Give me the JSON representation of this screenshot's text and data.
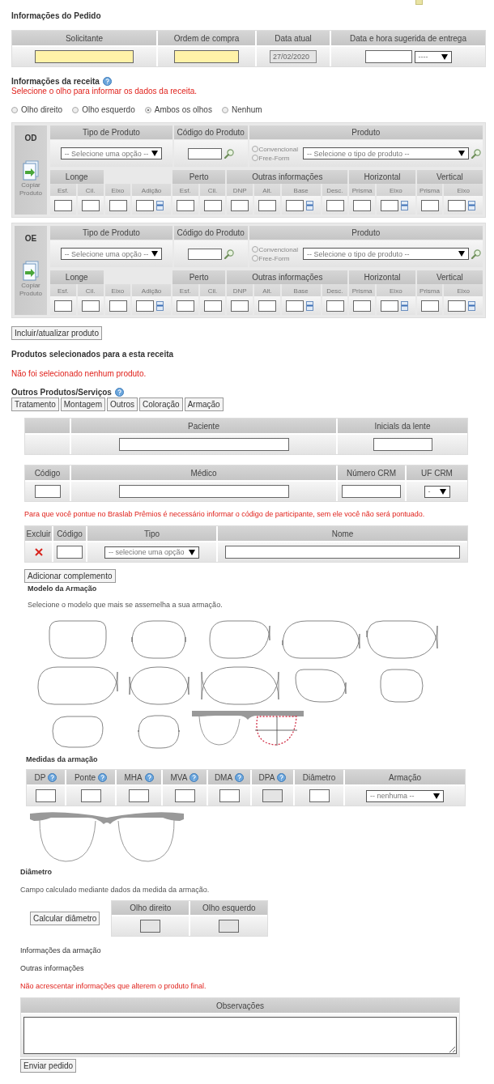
{
  "order": {
    "title": "Informações do Pedido",
    "headers": [
      "Solicitante",
      "Ordem de compra",
      "Data atual",
      "Data e hora sugerida de entrega"
    ],
    "fields": [
      {
        "kind": "text",
        "highlighted": true
      },
      {
        "kind": "text",
        "highlighted": true
      },
      {
        "kind": "readonly",
        "highlighted": false,
        "value": "27/02/2020"
      },
      {
        "kind": "datetime",
        "highlighted": false,
        "option": "----"
      }
    ]
  },
  "prescription": {
    "title": "Informações da receita",
    "note": "Selecione o olho para informar os dados da receita.",
    "eyes": [
      {
        "label": "Olho direito",
        "selected": false
      },
      {
        "label": "Olho esquerdo",
        "selected": false
      },
      {
        "label": "Ambos os olhos",
        "selected": true
      },
      {
        "label": "Nenhum",
        "selected": false
      }
    ]
  },
  "eye_panels": [
    {
      "eye": "OD",
      "copy_label": "Copiar Produto",
      "headers": [
        "Tipo de Produto",
        "Código do Produto",
        "Produto"
      ],
      "type_option": "-- Selecione uma opção --",
      "lens_options": [
        {
          "label": "Convencional",
          "selected": false
        },
        {
          "label": "Free-Form",
          "selected": false
        }
      ],
      "product_option": "-- Selecione o tipo de produto --",
      "groups": [
        {
          "label": "Longe",
          "columns": [
            {
              "label": "Esf.",
              "picker": false
            },
            {
              "label": "Cil.",
              "picker": false
            }
          ]
        },
        {
          "columns": [
            {
              "label": "Eixo",
              "picker": false
            },
            {
              "label": "Adição",
              "picker": true
            }
          ]
        },
        {
          "label": "Perto",
          "columns": [
            {
              "label": "Esf.",
              "picker": false
            },
            {
              "label": "Cil.",
              "picker": false
            }
          ]
        },
        {
          "label": "Outras informações",
          "columns": [
            {
              "label": "DNP",
              "picker": false
            },
            {
              "label": "Alt.",
              "picker": false
            },
            {
              "label": "Base",
              "picker": true
            },
            {
              "label": "Desc.",
              "picker": false
            }
          ]
        },
        {
          "label": "Horizontal",
          "columns": [
            {
              "label": "Prisma",
              "picker": false
            },
            {
              "label": "Eixo",
              "picker": true
            }
          ]
        },
        {
          "label": "Vertical",
          "columns": [
            {
              "label": "Prisma",
              "picker": false
            },
            {
              "label": "Eixo",
              "picker": true
            }
          ]
        }
      ]
    },
    {
      "eye": "OE",
      "copy_label": "Copiar Produto",
      "headers": [
        "Tipo de Produto",
        "Código do Produto",
        "Produto"
      ],
      "type_option": "-- Selecione uma opção --",
      "lens_options": [
        {
          "label": "Convencional",
          "selected": false
        },
        {
          "label": "Free-Form",
          "selected": false
        }
      ],
      "product_option": "-- Selecione o tipo de produto --",
      "groups": [
        {
          "label": "Longe",
          "columns": [
            {
              "label": "Esf.",
              "picker": false
            },
            {
              "label": "Cil.",
              "picker": false
            }
          ]
        },
        {
          "columns": [
            {
              "label": "Eixo",
              "picker": false
            },
            {
              "label": "Adição",
              "picker": true
            }
          ]
        },
        {
          "label": "Perto",
          "columns": [
            {
              "label": "Esf.",
              "picker": false
            },
            {
              "label": "Cil.",
              "picker": false
            }
          ]
        },
        {
          "label": "Outras informações",
          "columns": [
            {
              "label": "DNP",
              "picker": false
            },
            {
              "label": "Alt.",
              "picker": false
            },
            {
              "label": "Base",
              "picker": true
            },
            {
              "label": "Desc.",
              "picker": false
            }
          ]
        },
        {
          "label": "Horizontal",
          "columns": [
            {
              "label": "Prisma",
              "picker": false
            },
            {
              "label": "Eixo",
              "picker": true
            }
          ]
        },
        {
          "label": "Vertical",
          "columns": [
            {
              "label": "Prisma",
              "picker": false
            },
            {
              "label": "Eixo",
              "picker": true
            }
          ]
        }
      ]
    }
  ],
  "include_button": "Incluir/atualizar produto",
  "selected_products": {
    "title": "Produtos selecionados para a esta receita",
    "note": "Não foi selecionado nenhum produto."
  },
  "other_services": {
    "title": "Outros Produtos/Serviços",
    "buttons": [
      "Tratamento",
      "Montagem",
      "Outros",
      "Coloração",
      "Armação"
    ]
  },
  "patient": {
    "headers": [
      "Paciente",
      "Inicials da lente"
    ]
  },
  "doctor": {
    "headers": [
      "Código",
      "Médico",
      "Número CRM",
      "UF CRM"
    ],
    "uf_option": "-"
  },
  "participant_note": "Para que você pontue no Braslab Prêmios é necessário informar o código de participante, sem ele você não será pontuado.",
  "complements": {
    "headers": [
      "Excluir",
      "Código",
      "Tipo",
      "Nome"
    ],
    "rows": [
      {
        "type_option": "-- selecione uma opção"
      }
    ]
  },
  "add_complement_button": "Adicionar complemento",
  "frame_model": {
    "title": "Modelo da Armação",
    "note": "Selecione o modelo que mais se assemelha a sua armação."
  },
  "measurements": {
    "title": "Medidas da armação",
    "columns": [
      {
        "label": "DP",
        "help": true,
        "disabled": false
      },
      {
        "label": "Ponte",
        "help": true,
        "disabled": false
      },
      {
        "label": "MHA",
        "help": true,
        "disabled": false
      },
      {
        "label": "MVA",
        "help": true,
        "disabled": false
      },
      {
        "label": "DMA",
        "help": true,
        "disabled": false
      },
      {
        "label": "DPA",
        "help": true,
        "disabled": true
      },
      {
        "label": "Diâmetro",
        "help": false,
        "disabled": false
      }
    ],
    "frame_header": "Armação",
    "frame_option": "-- nenhuma --"
  },
  "diameter": {
    "title": "Diâmetro",
    "note": "Campo calculado mediante dados da medida da armação.",
    "button": "Calcular diâmetro",
    "headers": [
      "Olho direito",
      "Olho esquerdo"
    ]
  },
  "frame_info": {
    "title": "Informações da armação"
  },
  "other_info": {
    "title": "Outras informações",
    "note": "Não acrescentar informações que alterem o produto final.",
    "observations_header": "Observações"
  },
  "submit_button": "Enviar pedido"
}
